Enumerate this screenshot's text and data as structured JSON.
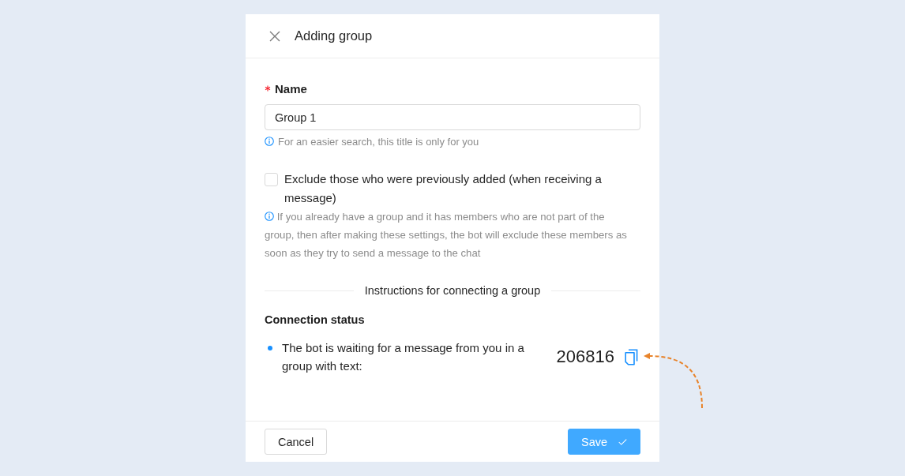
{
  "dialog": {
    "title": "Adding group"
  },
  "name_field": {
    "label": "Name",
    "required": true,
    "value": "Group 1",
    "hint": "For an easier search, this title is only for you"
  },
  "exclude_option": {
    "label": "Exclude those who were previously added (when receiving a message)",
    "checked": false,
    "hint": "If you already have a group and it has members who are not part of the group, then after making these settings, the bot will exclude these members as soon as they try to send a message to the chat"
  },
  "divider": {
    "text": "Instructions for connecting a group"
  },
  "connection": {
    "title": "Connection status",
    "items": [
      {
        "text": "The bot is waiting for a message from you in a group with text:"
      }
    ],
    "code": "206816"
  },
  "buttons": [
    {
      "label": "Cancel",
      "kind": "secondary"
    },
    {
      "label": "Save",
      "kind": "primary"
    }
  ]
}
